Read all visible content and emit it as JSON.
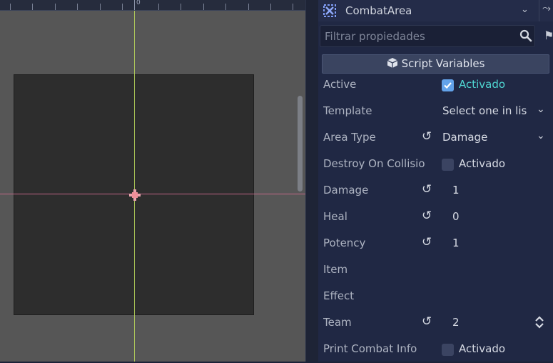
{
  "viewport": {
    "ruler_label": "0"
  },
  "inspector": {
    "node_name": "CombatArea",
    "filter_placeholder": "Filtrar propiedades",
    "section_title": "Script Variables",
    "properties": {
      "active": {
        "label": "Active",
        "checked": true,
        "text": "Activado"
      },
      "template": {
        "label": "Template",
        "value": "Select one in lis"
      },
      "area_type": {
        "label": "Area Type",
        "value": "Damage"
      },
      "destroy_on_collision": {
        "label": "Destroy On Collisio",
        "checked": false,
        "text": "Activado"
      },
      "damage": {
        "label": "Damage",
        "value": "1"
      },
      "heal": {
        "label": "Heal",
        "value": "0"
      },
      "potency": {
        "label": "Potency",
        "value": "1"
      },
      "item": {
        "label": "Item"
      },
      "effect": {
        "label": "Effect"
      },
      "team": {
        "label": "Team",
        "value": "2"
      },
      "print_combat_info": {
        "label": "Print Combat Info",
        "checked": false,
        "text": "Activado"
      }
    }
  },
  "colors": {
    "axis_x": "#d06a8e",
    "axis_y": "#b9d65a",
    "checkbox_on": "#63a3ea",
    "checkbox_on_text": "#4fd6d2",
    "panel_bg": "#202844"
  }
}
